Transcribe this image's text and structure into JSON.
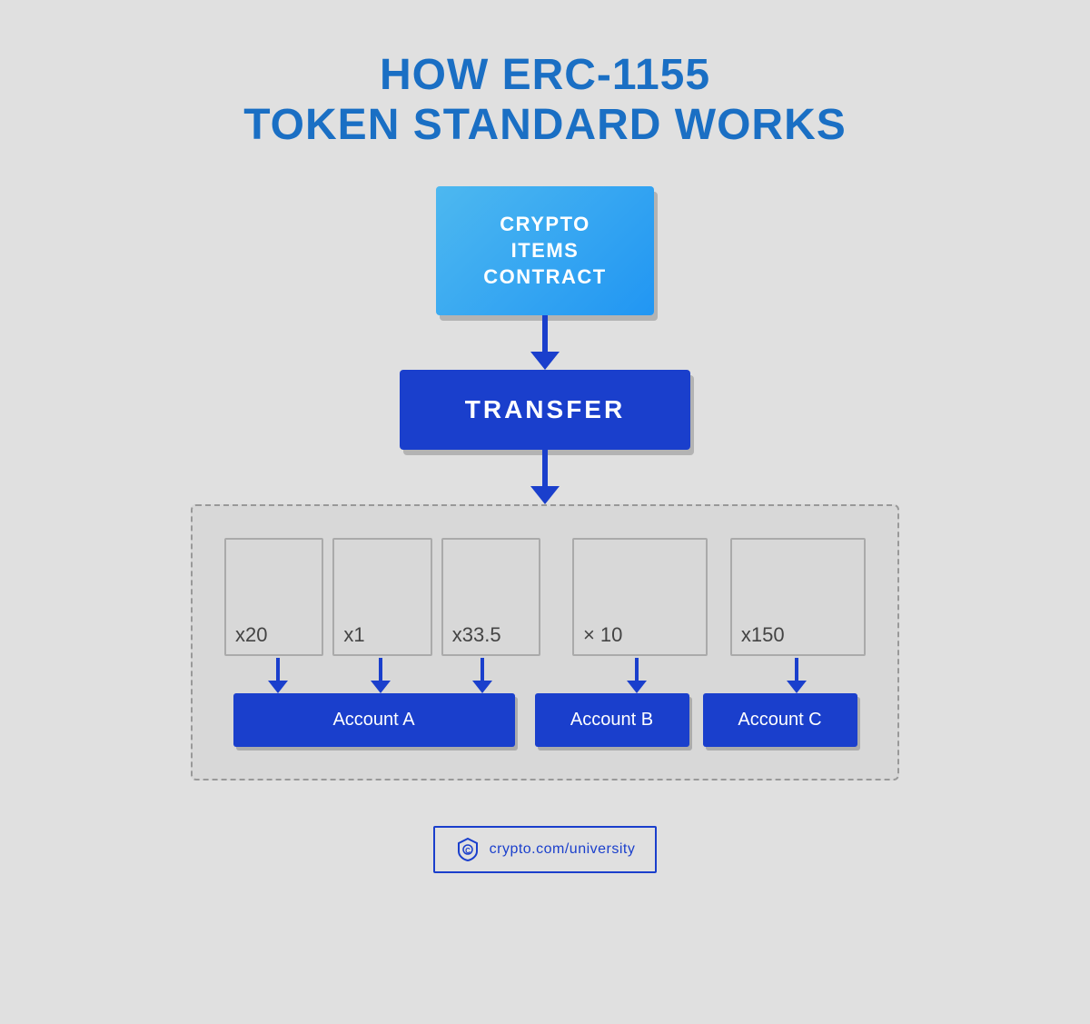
{
  "title": {
    "line1": "HOW ERC-1155",
    "line2": "TOKEN STANDARD WORKS"
  },
  "contract": {
    "label": "CRYPTO ITEMS CONTRACT"
  },
  "transfer": {
    "label": "TRANSFER"
  },
  "tokens": {
    "group_a": [
      {
        "quantity": "x20"
      },
      {
        "quantity": "x1"
      },
      {
        "quantity": "x33.5"
      }
    ],
    "group_b": [
      {
        "quantity": "×10"
      }
    ],
    "group_c": [
      {
        "quantity": "x150"
      }
    ]
  },
  "accounts": [
    {
      "label": "Account A"
    },
    {
      "label": "Account B"
    },
    {
      "label": "Account C"
    }
  ],
  "footer": {
    "text": "crypto.com/university"
  }
}
